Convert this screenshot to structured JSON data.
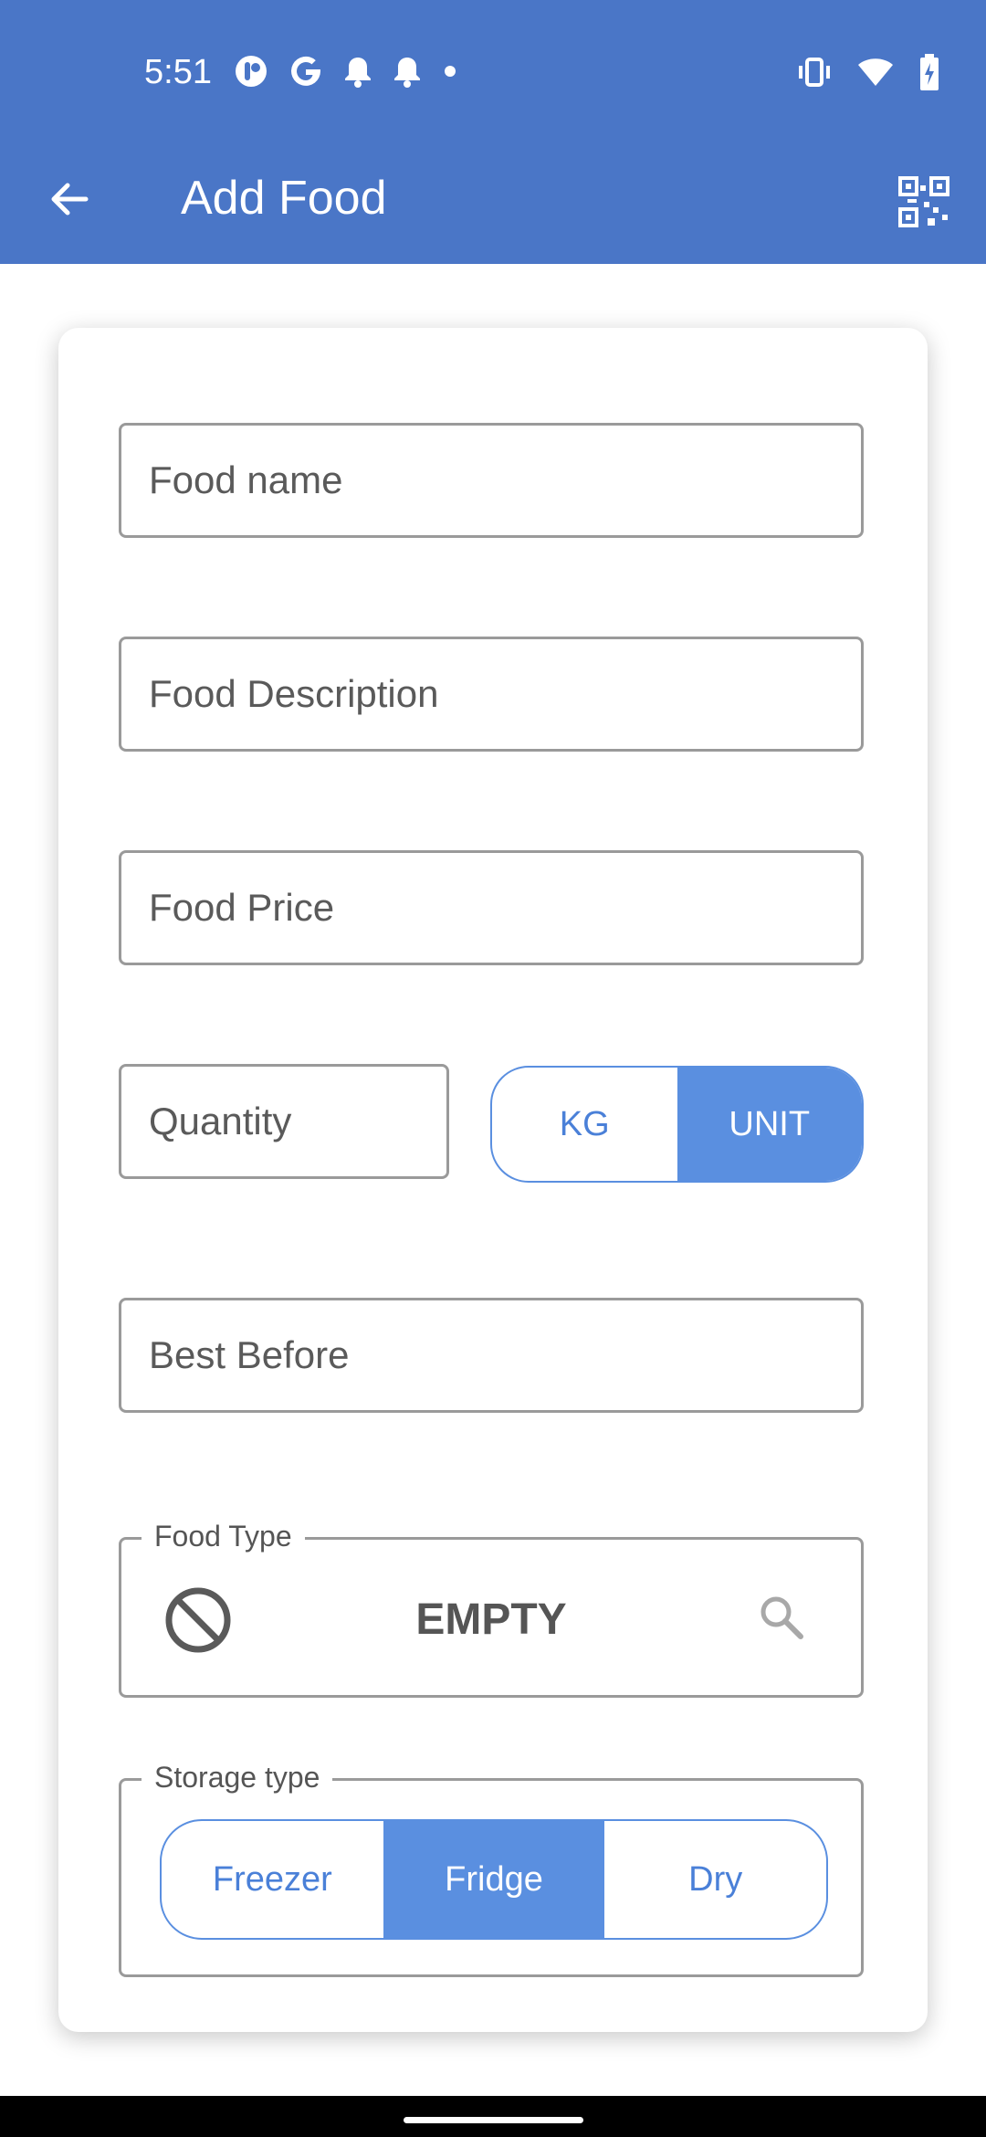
{
  "status_bar": {
    "time": "5:51",
    "left_icons": [
      "app-icon",
      "google-icon",
      "bell-icon",
      "bell-icon",
      "dot-icon"
    ],
    "right_icons": [
      "vibrate-icon",
      "wifi-icon",
      "battery-charging-icon"
    ]
  },
  "app_bar": {
    "title": "Add Food",
    "back_icon": "arrow-left-icon",
    "qr_icon": "qr-code-scan-icon",
    "color": "#4a76c7"
  },
  "form": {
    "food_name": {
      "placeholder": "Food name",
      "value": ""
    },
    "food_description": {
      "placeholder": "Food Description",
      "value": ""
    },
    "food_price": {
      "placeholder": "Food Price",
      "value": ""
    },
    "quantity": {
      "placeholder": "Quantity",
      "value": ""
    },
    "unit_toggle": {
      "options": [
        "KG",
        "UNIT"
      ],
      "selected": "UNIT"
    },
    "best_before": {
      "placeholder": "Best Before",
      "value": ""
    },
    "food_type": {
      "legend": "Food Type",
      "value": "EMPTY",
      "left_icon": "block-icon",
      "right_icon": "search-icon"
    },
    "storage_type": {
      "legend": "Storage type",
      "options": [
        "Freezer",
        "Fridge",
        "Dry"
      ],
      "selected": "Fridge"
    }
  },
  "accent_color": "#5a8fe0"
}
